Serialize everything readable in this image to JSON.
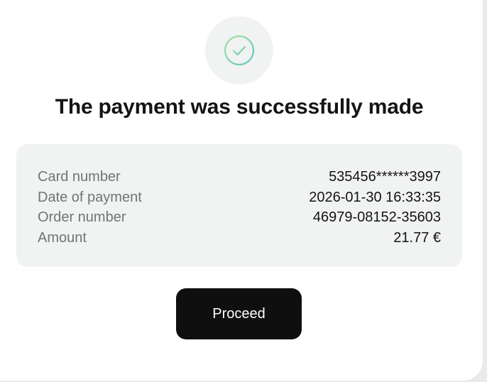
{
  "icons": {
    "status": "check-circle-icon"
  },
  "colors": {
    "check_gradient_start": "#9fe0a3",
    "check_gradient_end": "#5fc7b8",
    "button_background": "#0f0f0f",
    "panel_background": "#f1f2f2"
  },
  "title": "The payment was successfully made",
  "details": [
    {
      "label": "Card number",
      "value": "535456******3997"
    },
    {
      "label": "Date of payment",
      "value": "2026-01-30 16:33:35"
    },
    {
      "label": "Order number",
      "value": "46979-08152-35603"
    },
    {
      "label": "Amount",
      "value": "21.77 €"
    }
  ],
  "proceed_label": "Proceed"
}
